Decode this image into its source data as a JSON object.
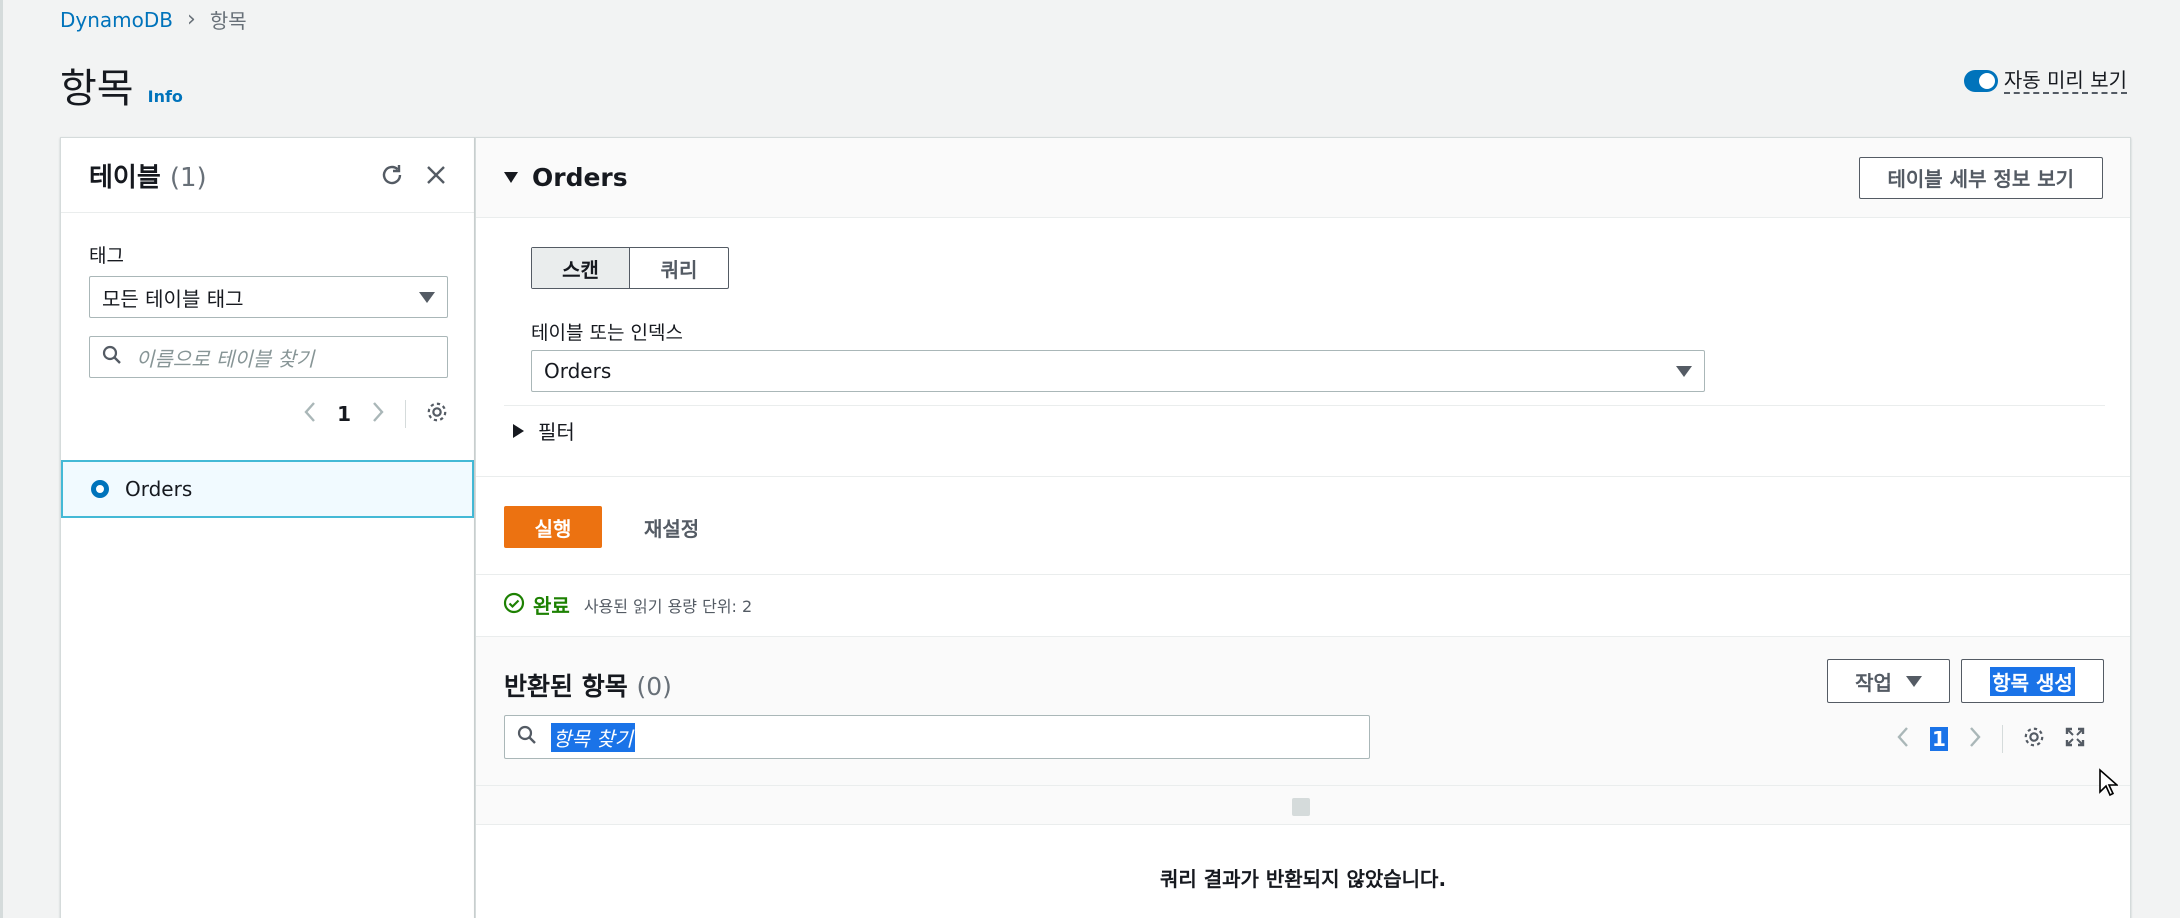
{
  "breadcrumb": {
    "root": "DynamoDB",
    "current": "항목"
  },
  "page": {
    "title": "항목",
    "info": "Info"
  },
  "toggle": {
    "label": "자동 미리 보기",
    "on": true
  },
  "tables_panel": {
    "title": "테이블",
    "count": "(1)",
    "tag_label": "태그",
    "tag_select": "모든 테이블 태그",
    "search_placeholder": "이름으로 테이블 찾기",
    "page": "1",
    "items": [
      {
        "label": "Orders",
        "selected": true
      }
    ]
  },
  "main": {
    "title": "Orders",
    "details_button": "테이블 세부 정보 보기",
    "mode_tabs": [
      "스캔",
      "쿼리"
    ],
    "active_mode": "스캔",
    "table_index_label": "테이블 또는 인덱스",
    "table_index_value": "Orders",
    "filter_label": "필터",
    "run_button": "실행",
    "reset_button": "재설정",
    "status": "완료",
    "capacity": "사용된 읽기 용량 단위: 2"
  },
  "results": {
    "title": "반환된 항목",
    "count": "(0)",
    "actions_button": "작업",
    "create_button": "항목 생성",
    "search_placeholder": "항목 찾기",
    "page": "1",
    "empty_message": "쿼리 결과가 반환되지 않았습니다."
  },
  "colors": {
    "accent": "#0073bb",
    "primary_button": "#ec7211",
    "success": "#1d8102",
    "selection": "#1a73e8"
  }
}
